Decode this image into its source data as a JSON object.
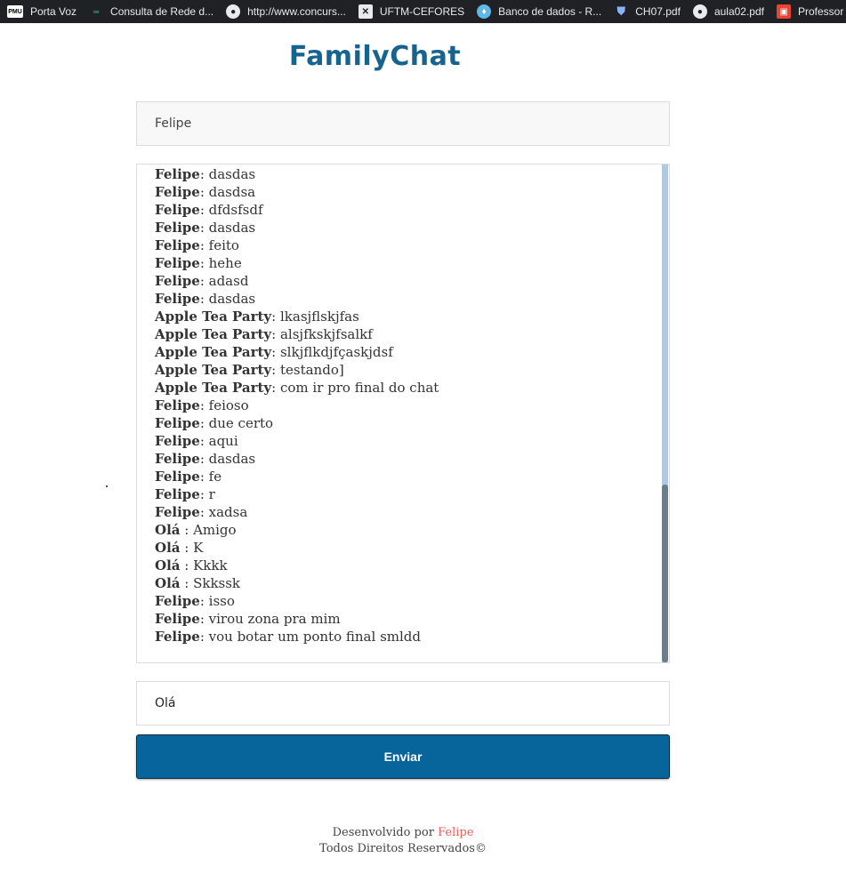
{
  "bookmarks": [
    {
      "label": "Porta Voz",
      "icon": "pmu-icon",
      "glyph": "PMU"
    },
    {
      "label": "Consulta de Rede d...",
      "icon": "onix-icon",
      "glyph": "∞"
    },
    {
      "label": "http://www.concurs...",
      "icon": "globe-icon",
      "glyph": "●"
    },
    {
      "label": "UFTM-CEFORES",
      "icon": "x-icon",
      "glyph": "✕"
    },
    {
      "label": "Banco de dados - R...",
      "icon": "lightbulb-icon",
      "glyph": "♦"
    },
    {
      "label": "CH07.pdf",
      "icon": "shield-icon",
      "glyph": "⛊"
    },
    {
      "label": "aula02.pdf",
      "icon": "globe-icon",
      "glyph": "●"
    },
    {
      "label": "Professor",
      "icon": "presentation-icon",
      "glyph": "▣"
    }
  ],
  "app": {
    "title": "FamilyChat"
  },
  "name_input": {
    "value": "Felipe"
  },
  "chat": {
    "messages": [
      {
        "author": "Felipe",
        "sep": ": ",
        "text": "dasdas"
      },
      {
        "author": "Felipe",
        "sep": ": ",
        "text": "dasdsa"
      },
      {
        "author": "Felipe",
        "sep": ": ",
        "text": "dfdsfsdf"
      },
      {
        "author": "Felipe",
        "sep": ": ",
        "text": "dasdas"
      },
      {
        "author": "Felipe",
        "sep": ": ",
        "text": "feito"
      },
      {
        "author": "Felipe",
        "sep": ": ",
        "text": "hehe"
      },
      {
        "author": "Felipe",
        "sep": ": ",
        "text": "adasd"
      },
      {
        "author": "Felipe",
        "sep": ": ",
        "text": "dasdas"
      },
      {
        "author": "Apple Tea Party",
        "sep": ": ",
        "text": "lkasjflskjfas"
      },
      {
        "author": "Apple Tea Party",
        "sep": ": ",
        "text": "alsjfkskjfsalkf"
      },
      {
        "author": "Apple Tea Party",
        "sep": ": ",
        "text": "slkjflkdjfçaskjdsf"
      },
      {
        "author": "Apple Tea Party",
        "sep": ": ",
        "text": "testando]"
      },
      {
        "author": "Apple Tea Party",
        "sep": ": ",
        "text": "com ir pro final do chat"
      },
      {
        "author": "Felipe",
        "sep": ": ",
        "text": "feioso"
      },
      {
        "author": "Felipe",
        "sep": ": ",
        "text": "due certo"
      },
      {
        "author": "Felipe",
        "sep": ": ",
        "text": "aqui"
      },
      {
        "author": "Felipe",
        "sep": ": ",
        "text": "dasdas"
      },
      {
        "author": "Felipe",
        "sep": ": ",
        "text": "fe"
      },
      {
        "author": "Felipe",
        "sep": ": ",
        "text": "r"
      },
      {
        "author": "Felipe",
        "sep": ": ",
        "text": "xadsa"
      },
      {
        "author": "Olá",
        "sep": " : ",
        "text": "Amigo"
      },
      {
        "author": "Olá",
        "sep": " : ",
        "text": "K"
      },
      {
        "author": "Olá",
        "sep": " : ",
        "text": "Kkkk"
      },
      {
        "author": "Olá",
        "sep": " : ",
        "text": "Skkssk"
      },
      {
        "author": "Felipe",
        "sep": ": ",
        "text": "isso"
      },
      {
        "author": "Felipe",
        "sep": ": ",
        "text": "virou zona pra mim"
      },
      {
        "author": "Felipe",
        "sep": ": ",
        "text": "vou botar um ponto final smldd"
      }
    ]
  },
  "message_input": {
    "value": "Olá"
  },
  "send_button": {
    "label": "Enviar"
  },
  "footer": {
    "developed_by": "Desenvolvido por ",
    "author_link": "Felipe",
    "rights": "Todos Direitos Reservados©"
  },
  "colors": {
    "brand": "#16638f",
    "button": "#07659c",
    "footer_link": "#e9605d"
  }
}
